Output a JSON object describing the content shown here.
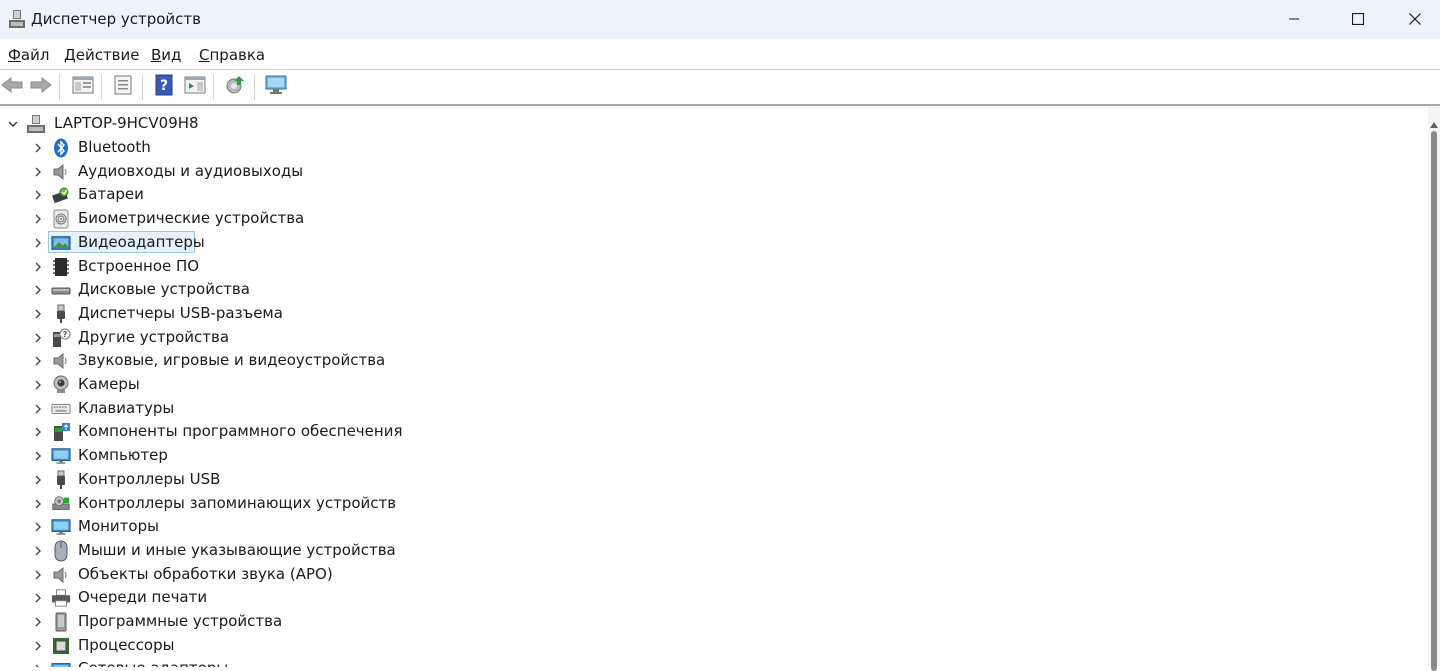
{
  "window": {
    "title": "Диспетчер устройств"
  },
  "menu": {
    "items": [
      {
        "label": "Файл",
        "accel": "Ф",
        "rest": "айл"
      },
      {
        "label": "Действие",
        "accel": "Д",
        "rest": "ействие"
      },
      {
        "label": "Вид",
        "accel": "В",
        "rest": "ид"
      },
      {
        "label": "Справка",
        "accel": "С",
        "rest": "правка"
      }
    ]
  },
  "toolbar": {
    "buttons": [
      "back-arrow-icon",
      "forward-arrow-icon",
      "show-hide-console-tree-icon",
      "properties-icon",
      "help-icon",
      "show-action-pane-icon",
      "update-driver-icon",
      "scan-hardware-icon"
    ]
  },
  "tree": {
    "root": {
      "label": "LAPTOP-9HCV09H8",
      "icon": "computer-network-icon"
    },
    "items": [
      {
        "label": "Bluetooth",
        "icon": "bluetooth-icon"
      },
      {
        "label": "Аудиовходы и аудиовыходы",
        "icon": "speaker-icon"
      },
      {
        "label": "Батареи",
        "icon": "battery-icon"
      },
      {
        "label": "Биометрические устройства",
        "icon": "fingerprint-icon"
      },
      {
        "label": "Видеоадаптеры",
        "icon": "display-adapter-icon",
        "selected": true
      },
      {
        "label": "Встроенное ПО",
        "icon": "firmware-chip-icon"
      },
      {
        "label": "Дисковые устройства",
        "icon": "disk-drive-icon"
      },
      {
        "label": "Диспетчеры USB-разъема",
        "icon": "usb-connector-icon"
      },
      {
        "label": "Другие устройства",
        "icon": "unknown-device-icon"
      },
      {
        "label": "Звуковые, игровые и видеоустройства",
        "icon": "speaker-icon"
      },
      {
        "label": "Камеры",
        "icon": "webcam-icon"
      },
      {
        "label": "Клавиатуры",
        "icon": "keyboard-icon"
      },
      {
        "label": "Компоненты программного обеспечения",
        "icon": "software-component-icon"
      },
      {
        "label": "Компьютер",
        "icon": "monitor-icon"
      },
      {
        "label": "Контроллеры USB",
        "icon": "usb-plug-icon"
      },
      {
        "label": "Контроллеры запоминающих устройств",
        "icon": "storage-controller-icon"
      },
      {
        "label": "Мониторы",
        "icon": "monitor-icon"
      },
      {
        "label": "Мыши и иные указывающие устройства",
        "icon": "mouse-icon"
      },
      {
        "label": "Объекты обработки звука (APO)",
        "icon": "speaker-icon"
      },
      {
        "label": "Очереди печати",
        "icon": "printer-icon"
      },
      {
        "label": "Программные устройства",
        "icon": "software-device-icon"
      },
      {
        "label": "Процессоры",
        "icon": "processor-icon"
      },
      {
        "label": "Сетевые адаптеры",
        "icon": "network-adapter-icon"
      }
    ]
  },
  "colors": {
    "titlebar_bg": "#eef3f9",
    "selection_bg": "#e5f1fb",
    "selection_border": "#99c9ef"
  }
}
